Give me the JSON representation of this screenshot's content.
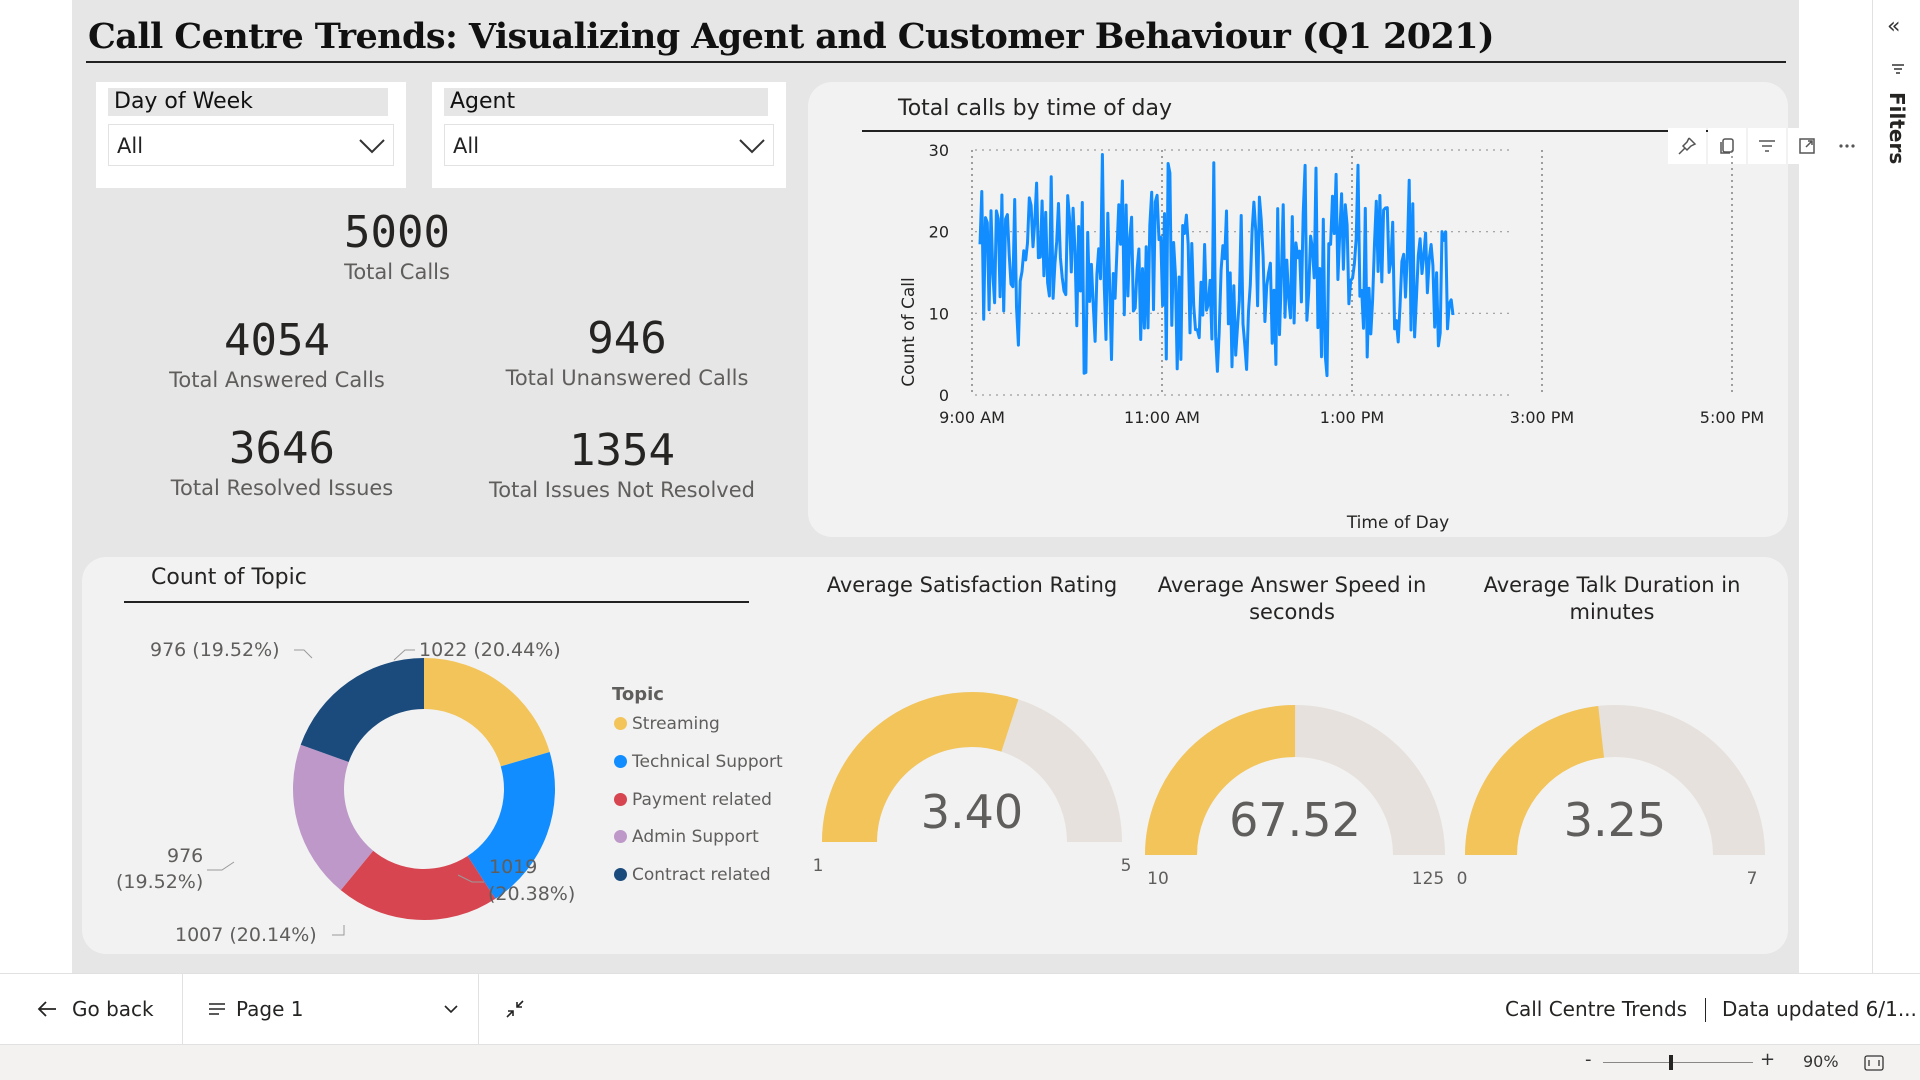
{
  "report": {
    "title": "Call Centre Trends: Visualizing Agent and Customer Behaviour (Q1 2021)"
  },
  "slicers": {
    "day_of_week": {
      "label": "Day of Week",
      "value": "All"
    },
    "agent": {
      "label": "Agent",
      "value": "All"
    }
  },
  "kpis": {
    "total_calls": {
      "value": "5000",
      "label": "Total Calls"
    },
    "answered": {
      "value": "4054",
      "label": "Total Answered Calls"
    },
    "unanswered": {
      "value": "946",
      "label": "Total Unanswered Calls"
    },
    "resolved": {
      "value": "3646",
      "label": "Total Resolved Issues"
    },
    "not_resolved": {
      "value": "1354",
      "label": "Total Issues Not Resolved"
    }
  },
  "line_chart": {
    "title": "Total calls by time of day",
    "xlabel": "Time of Day",
    "ylabel": "Count of Call",
    "y_ticks": [
      "0",
      "10",
      "20",
      "30"
    ],
    "x_ticks": [
      "9:00 AM",
      "11:00 AM",
      "1:00 PM",
      "3:00 PM",
      "5:00 PM"
    ],
    "color": "#118dff"
  },
  "donut": {
    "title": "Count of Topic",
    "legend_title": "Topic",
    "slices": [
      {
        "name": "Streaming",
        "value": 1022,
        "label": "1022 (20.44%)",
        "color": "#f2c45a"
      },
      {
        "name": "Technical Support",
        "value": 1019,
        "label_l1": "1019",
        "label_l2": "(20.38%)",
        "color": "#118dff"
      },
      {
        "name": "Payment related",
        "value": 1007,
        "label": "1007 (20.14%)",
        "color": "#d64550"
      },
      {
        "name": "Admin Support",
        "value": 976,
        "label_l1": "976",
        "label_l2": "(19.52%)",
        "color": "#bd98c8"
      },
      {
        "name": "Contract related",
        "value": 976,
        "label": "976 (19.52%)",
        "color": "#1b4b7c"
      }
    ]
  },
  "gauges": [
    {
      "title": "Average Satisfaction Rating",
      "value_text": "3.40",
      "value": 3.4,
      "min": 1,
      "max": 5,
      "min_text": "1",
      "max_text": "5"
    },
    {
      "title": "Average Answer Speed in seconds",
      "value_text": "67.52",
      "value": 67.52,
      "min": 10,
      "max": 125,
      "min_text": "10",
      "max_text": "125"
    },
    {
      "title": "Average Talk Duration in minutes",
      "value_text": "3.25",
      "value": 3.25,
      "min": 0,
      "max": 7,
      "min_text": "0",
      "max_text": "7"
    }
  ],
  "gauge_colors": {
    "fill": "#f2c45a",
    "track": "#e6e1dc"
  },
  "bottom_bar": {
    "go_back": "Go back",
    "page": "Page 1",
    "report_name": "Call Centre Trends",
    "data_updated": "Data updated 6/1..."
  },
  "status_bar": {
    "zoom_minus": "-",
    "zoom_plus": "+",
    "zoom": "90%",
    "zoom_fraction": 0.45
  },
  "right_pane": {
    "label": "Filters",
    "collapse_glyph": "«"
  },
  "icons": {
    "back": "arrow-left-icon",
    "page_menu": "hamburger-icon",
    "chevron": "chevron-down-icon",
    "collapse": "collapse-arrows-icon",
    "fit": "fit-page-icon",
    "toolbar": [
      "pin-icon",
      "copy-icon",
      "filter-icon",
      "focus-mode-icon",
      "more-options-icon"
    ]
  }
}
